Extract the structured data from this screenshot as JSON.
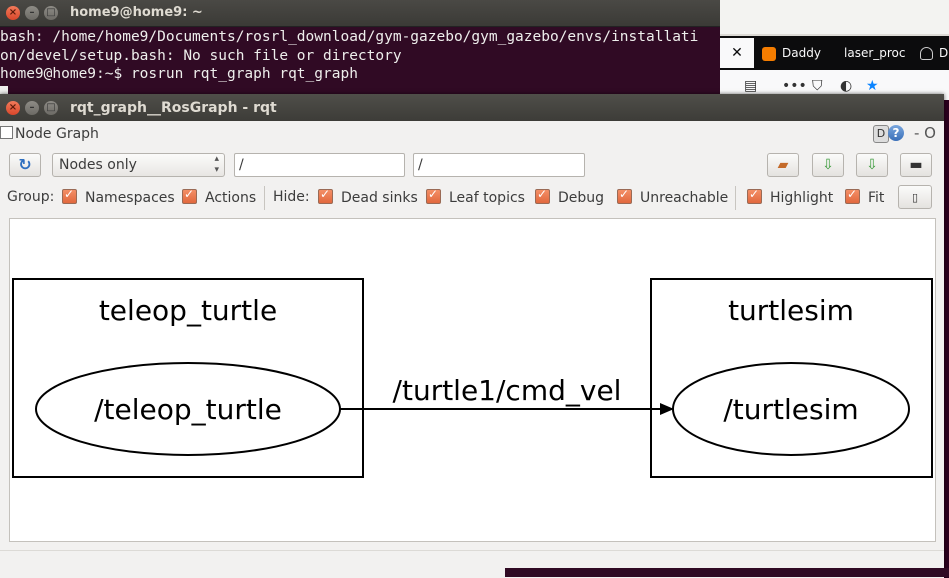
{
  "terminal": {
    "title": "home9@home9: ~",
    "lines": [
      "bash: /home/home9/Documents/rosrl_download/gym-gazebo/gym_gazebo/envs/installati",
      "on/devel/setup.bash: No such file or directory",
      "home9@home9:~$ rosrun rqt_graph rqt_graph"
    ]
  },
  "browser": {
    "tabs": [
      {
        "label": "Daddy",
        "icon": "blogger-icon"
      },
      {
        "label": "laser_proc"
      },
      {
        "label": "D",
        "icon": "ghost-icon"
      }
    ]
  },
  "window": {
    "title": "rqt_graph__RosGraph - rqt",
    "plugin_title": "Node Graph",
    "d_label": "D",
    "help_label": "?",
    "extra_label": "- O"
  },
  "toolbar": {
    "display_mode": "Nodes only",
    "ns_filter": "/",
    "topic_filter": "/"
  },
  "options": {
    "group_label": "Group:",
    "namespaces": "Namespaces",
    "actions": "Actions",
    "hide_label": "Hide:",
    "dead_sinks": "Dead sinks",
    "leaf_topics": "Leaf topics",
    "debug": "Debug",
    "unreachable": "Unreachable",
    "highlight": "Highlight",
    "fit": "Fit"
  },
  "graph": {
    "namespaces": [
      {
        "label": "teleop_turtle",
        "node": "/teleop_turtle"
      },
      {
        "label": "turtlesim",
        "node": "/turtlesim"
      }
    ],
    "edge_label": "/turtle1/cmd_vel"
  },
  "colors": {
    "terminal_bg": "#300a24",
    "checkbox_accent": "#e8714a",
    "close_button": "#e0512f"
  }
}
